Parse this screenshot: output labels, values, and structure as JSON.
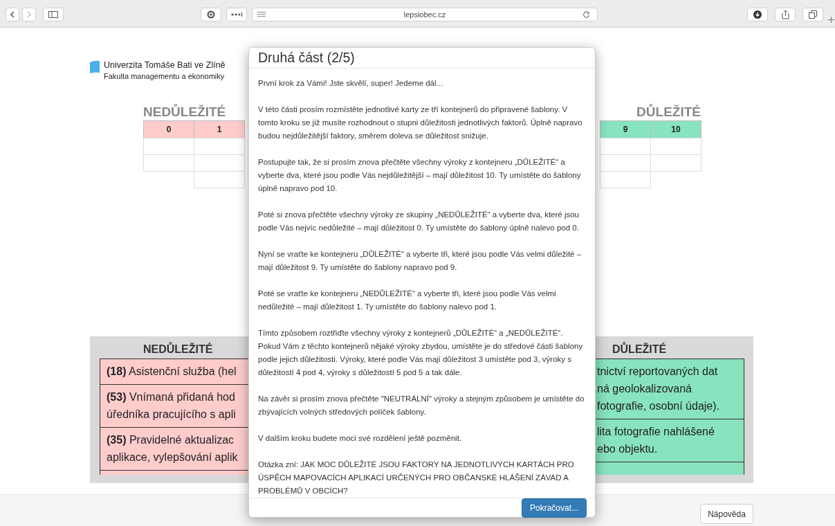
{
  "browser": {
    "url": "lepsiobec.cz"
  },
  "logo": {
    "title": "Univerzita Tomáše Bati ve Zlíně",
    "subtitle": "Fakulta managementu a ekonomiky"
  },
  "template": {
    "left_heading": "NEDŮLEŽITÉ",
    "right_heading": "DŮLEŽITÉ",
    "columns": [
      {
        "label": "0",
        "color": "#ffcccc"
      },
      {
        "label": "1",
        "color": "#ffcccc"
      },
      {
        "label": "9",
        "color": "#88e3bf"
      },
      {
        "label": "10",
        "color": "#88e3bf"
      }
    ]
  },
  "containers": [
    {
      "heading": "NEDŮLEŽITÉ",
      "color": "#ffcccc",
      "cards": [
        {
          "lines": [
            "**(18)** Asistenční služba (hel"
          ]
        },
        {
          "lines": [
            "**(53)** Vnímaná přidaná hod",
            "úředníka pracujícího s apli"
          ]
        },
        {
          "lines": [
            "**(35)** Pravidelné aktualizac",
            "aplikace, vylepšování aplik"
          ]
        }
      ]
    },
    {
      "heading": "DŮLEŽITÉ",
      "color": "#88e3bf",
      "cards": [
        {
          "lines": [
            "tnictví reportovaných dat",
            "ná geolokalizovaná",
            "fotografie, osobní údaje)."
          ]
        },
        {
          "lines": [
            "lita fotografie nahlášené",
            "ebo objektu."
          ]
        }
      ]
    }
  ],
  "modal": {
    "title": "Druhá část (2/5)",
    "paragraphs": [
      "První krok za Vámi! Jste skvělí, super! Jedeme dál...",
      "V této části prosím rozmístěte jednotlivé karty ze tří kontejnerů do připravené šablony. V tomto kroku se již musíte rozhodnout o stupni důležitosti jednotlivých faktorů. Úplně napravo budou nejdůležitější faktory, směrem doleva se důležitost snižuje.",
      "Postupujte tak, že si prosím znova přečtěte všechny výroky z kontejneru „DŮLEŽITÉ“ a vyberte dva, které jsou podle Vás nejdůležitější – mají důležitost 10. Ty umístěte do šablony úplně napravo pod 10.",
      "Poté si znova přečtěte všechny výroky ze skupiny „NEDŮLEŽITÉ“ a vyberte dva, které jsou podle Vás nejvíc nedůležité – mají důležitost 0. Ty umístěte do šablony úplně nalevo pod 0.",
      "Nyní se vraťte ke kontejneru „DŮLEŽITÉ“ a vyberte tři, které jsou podle Vás velmi důležité – mají důležitost 9. Ty umístěte do šablony napravo pod 9.",
      "Poté se vraťte ke kontejneru „NEDŮLEŽITÉ“ a vyberte tři, které jsou podle Vás velmi nedůležité – mají důležitost 1. Ty umístěte do šablony nalevo pod 1.",
      "Tímto způsobem roztřiďte všechny výroky z kontejnerů „DŮLEŽITÉ“ a „NEDŮLEŽITÉ“. Pokud Vám z těchto kontejnerů nějaké výroky zbydou, umístěte je do středové části šablony podle jejich důležitosti. Výroky, které podle Vás mají důležitost 3 umístěte pod 3, výroky s důležitostí 4 pod 4, výroky s důležitostí 5 pod 5 a tak dále.",
      "Na závěr si prosím znova přečtěte \"NEUTRÁLNÍ\" výroky a stejným způsobem je umístěte do zbývajících volných středových políček šablony.",
      "V dalším kroku budete moci své rozdělení ještě pozměnit.",
      "Otázka zní: JAK MOC DŮLEŽITÉ JSOU FAKTORY NA JEDNOTLIVÝCH KARTÁCH PRO ÚSPĚCH MAPOVACÍCH APLIKACÍ URČENÝCH PRO OBČANSKÉ HLÁŠENÍ ZÁVAD A PROBLÉMŮ V OBCÍCH?"
    ],
    "button": "Pokračovat..."
  },
  "help_button": "Nápověda"
}
